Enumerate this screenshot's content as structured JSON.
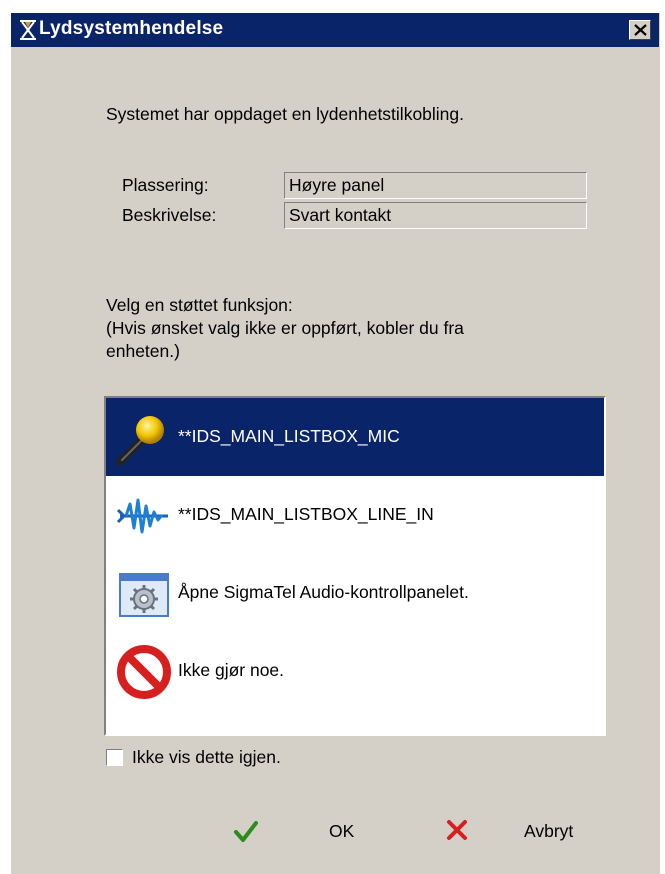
{
  "window": {
    "title": "Lydsystemhendelse",
    "close_icon": "close-icon",
    "title_icon": "audio-event-icon"
  },
  "message": "Systemet har oppdaget en lydenhetstilkobling.",
  "details": {
    "location_label": "Plassering:",
    "location_value": "Høyre panel",
    "description_label": "Beskrivelse:",
    "description_value": "Svart kontakt"
  },
  "prompt": {
    "line1": "Velg en støttet funksjon:",
    "line2": "(Hvis ønsket valg ikke er oppført, kobler du fra",
    "line3": "enheten.)"
  },
  "options": [
    {
      "label": "**IDS_MAIN_LISTBOX_MIC",
      "icon": "microphone-icon",
      "selected": true
    },
    {
      "label": "**IDS_MAIN_LISTBOX_LINE_IN",
      "icon": "line-in-wave-icon",
      "selected": false
    },
    {
      "label": "Åpne SigmaTel Audio-kontrollpanelet.",
      "icon": "control-panel-gear-icon",
      "selected": false
    },
    {
      "label": "Ikke gjør noe.",
      "icon": "no-action-icon",
      "selected": false
    }
  ],
  "dont_show_again": {
    "label": "Ikke vis dette igjen.",
    "checked": false
  },
  "buttons": {
    "ok_label": "OK",
    "ok_icon": "checkmark-icon",
    "cancel_label": "Avbryt",
    "cancel_icon": "x-icon"
  },
  "colors": {
    "titlebar": "#0a246a",
    "dialog_bg": "#d4d0c8",
    "selection": "#0a246a",
    "ok_green": "#2e8b1e",
    "cancel_red": "#d81e1e",
    "no_sign_red": "#d62020"
  }
}
